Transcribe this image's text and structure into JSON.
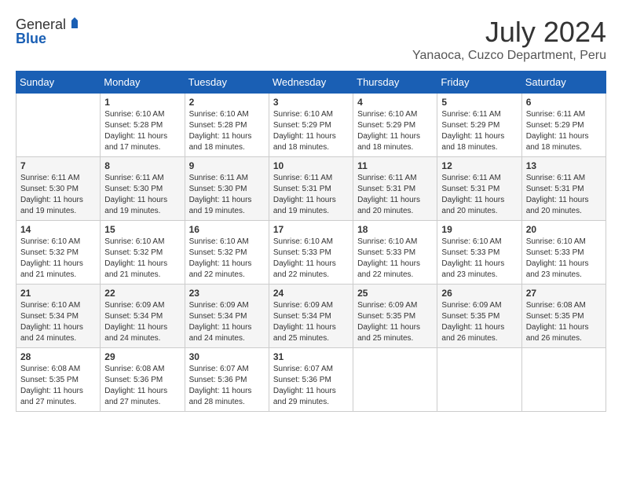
{
  "header": {
    "logo_general": "General",
    "logo_blue": "Blue",
    "month": "July 2024",
    "location": "Yanaoca, Cuzco Department, Peru"
  },
  "weekdays": [
    "Sunday",
    "Monday",
    "Tuesday",
    "Wednesday",
    "Thursday",
    "Friday",
    "Saturday"
  ],
  "weeks": [
    [
      {
        "day": "",
        "sunrise": "",
        "sunset": "",
        "daylight": ""
      },
      {
        "day": "1",
        "sunrise": "Sunrise: 6:10 AM",
        "sunset": "Sunset: 5:28 PM",
        "daylight": "Daylight: 11 hours and 17 minutes."
      },
      {
        "day": "2",
        "sunrise": "Sunrise: 6:10 AM",
        "sunset": "Sunset: 5:28 PM",
        "daylight": "Daylight: 11 hours and 18 minutes."
      },
      {
        "day": "3",
        "sunrise": "Sunrise: 6:10 AM",
        "sunset": "Sunset: 5:29 PM",
        "daylight": "Daylight: 11 hours and 18 minutes."
      },
      {
        "day": "4",
        "sunrise": "Sunrise: 6:10 AM",
        "sunset": "Sunset: 5:29 PM",
        "daylight": "Daylight: 11 hours and 18 minutes."
      },
      {
        "day": "5",
        "sunrise": "Sunrise: 6:11 AM",
        "sunset": "Sunset: 5:29 PM",
        "daylight": "Daylight: 11 hours and 18 minutes."
      },
      {
        "day": "6",
        "sunrise": "Sunrise: 6:11 AM",
        "sunset": "Sunset: 5:29 PM",
        "daylight": "Daylight: 11 hours and 18 minutes."
      }
    ],
    [
      {
        "day": "7",
        "sunrise": "Sunrise: 6:11 AM",
        "sunset": "Sunset: 5:30 PM",
        "daylight": "Daylight: 11 hours and 19 minutes."
      },
      {
        "day": "8",
        "sunrise": "Sunrise: 6:11 AM",
        "sunset": "Sunset: 5:30 PM",
        "daylight": "Daylight: 11 hours and 19 minutes."
      },
      {
        "day": "9",
        "sunrise": "Sunrise: 6:11 AM",
        "sunset": "Sunset: 5:30 PM",
        "daylight": "Daylight: 11 hours and 19 minutes."
      },
      {
        "day": "10",
        "sunrise": "Sunrise: 6:11 AM",
        "sunset": "Sunset: 5:31 PM",
        "daylight": "Daylight: 11 hours and 19 minutes."
      },
      {
        "day": "11",
        "sunrise": "Sunrise: 6:11 AM",
        "sunset": "Sunset: 5:31 PM",
        "daylight": "Daylight: 11 hours and 20 minutes."
      },
      {
        "day": "12",
        "sunrise": "Sunrise: 6:11 AM",
        "sunset": "Sunset: 5:31 PM",
        "daylight": "Daylight: 11 hours and 20 minutes."
      },
      {
        "day": "13",
        "sunrise": "Sunrise: 6:11 AM",
        "sunset": "Sunset: 5:31 PM",
        "daylight": "Daylight: 11 hours and 20 minutes."
      }
    ],
    [
      {
        "day": "14",
        "sunrise": "Sunrise: 6:10 AM",
        "sunset": "Sunset: 5:32 PM",
        "daylight": "Daylight: 11 hours and 21 minutes."
      },
      {
        "day": "15",
        "sunrise": "Sunrise: 6:10 AM",
        "sunset": "Sunset: 5:32 PM",
        "daylight": "Daylight: 11 hours and 21 minutes."
      },
      {
        "day": "16",
        "sunrise": "Sunrise: 6:10 AM",
        "sunset": "Sunset: 5:32 PM",
        "daylight": "Daylight: 11 hours and 22 minutes."
      },
      {
        "day": "17",
        "sunrise": "Sunrise: 6:10 AM",
        "sunset": "Sunset: 5:33 PM",
        "daylight": "Daylight: 11 hours and 22 minutes."
      },
      {
        "day": "18",
        "sunrise": "Sunrise: 6:10 AM",
        "sunset": "Sunset: 5:33 PM",
        "daylight": "Daylight: 11 hours and 22 minutes."
      },
      {
        "day": "19",
        "sunrise": "Sunrise: 6:10 AM",
        "sunset": "Sunset: 5:33 PM",
        "daylight": "Daylight: 11 hours and 23 minutes."
      },
      {
        "day": "20",
        "sunrise": "Sunrise: 6:10 AM",
        "sunset": "Sunset: 5:33 PM",
        "daylight": "Daylight: 11 hours and 23 minutes."
      }
    ],
    [
      {
        "day": "21",
        "sunrise": "Sunrise: 6:10 AM",
        "sunset": "Sunset: 5:34 PM",
        "daylight": "Daylight: 11 hours and 24 minutes."
      },
      {
        "day": "22",
        "sunrise": "Sunrise: 6:09 AM",
        "sunset": "Sunset: 5:34 PM",
        "daylight": "Daylight: 11 hours and 24 minutes."
      },
      {
        "day": "23",
        "sunrise": "Sunrise: 6:09 AM",
        "sunset": "Sunset: 5:34 PM",
        "daylight": "Daylight: 11 hours and 24 minutes."
      },
      {
        "day": "24",
        "sunrise": "Sunrise: 6:09 AM",
        "sunset": "Sunset: 5:34 PM",
        "daylight": "Daylight: 11 hours and 25 minutes."
      },
      {
        "day": "25",
        "sunrise": "Sunrise: 6:09 AM",
        "sunset": "Sunset: 5:35 PM",
        "daylight": "Daylight: 11 hours and 25 minutes."
      },
      {
        "day": "26",
        "sunrise": "Sunrise: 6:09 AM",
        "sunset": "Sunset: 5:35 PM",
        "daylight": "Daylight: 11 hours and 26 minutes."
      },
      {
        "day": "27",
        "sunrise": "Sunrise: 6:08 AM",
        "sunset": "Sunset: 5:35 PM",
        "daylight": "Daylight: 11 hours and 26 minutes."
      }
    ],
    [
      {
        "day": "28",
        "sunrise": "Sunrise: 6:08 AM",
        "sunset": "Sunset: 5:35 PM",
        "daylight": "Daylight: 11 hours and 27 minutes."
      },
      {
        "day": "29",
        "sunrise": "Sunrise: 6:08 AM",
        "sunset": "Sunset: 5:36 PM",
        "daylight": "Daylight: 11 hours and 27 minutes."
      },
      {
        "day": "30",
        "sunrise": "Sunrise: 6:07 AM",
        "sunset": "Sunset: 5:36 PM",
        "daylight": "Daylight: 11 hours and 28 minutes."
      },
      {
        "day": "31",
        "sunrise": "Sunrise: 6:07 AM",
        "sunset": "Sunset: 5:36 PM",
        "daylight": "Daylight: 11 hours and 29 minutes."
      },
      {
        "day": "",
        "sunrise": "",
        "sunset": "",
        "daylight": ""
      },
      {
        "day": "",
        "sunrise": "",
        "sunset": "",
        "daylight": ""
      },
      {
        "day": "",
        "sunrise": "",
        "sunset": "",
        "daylight": ""
      }
    ]
  ]
}
